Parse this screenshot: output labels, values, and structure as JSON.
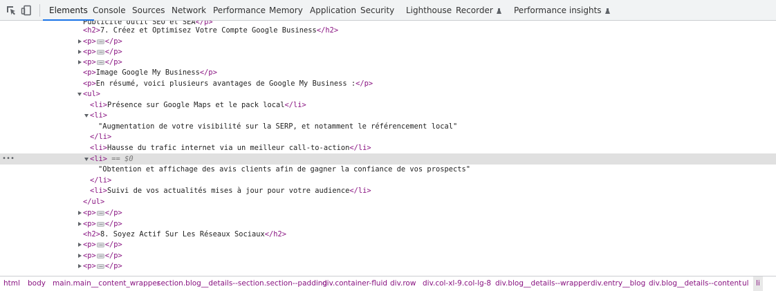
{
  "toolbar": {
    "tabs": [
      {
        "label": "Elements",
        "active": true
      },
      {
        "label": "Console"
      },
      {
        "label": "Sources"
      },
      {
        "label": "Network"
      },
      {
        "label": "Performance"
      },
      {
        "label": "Memory"
      },
      {
        "label": "Application"
      },
      {
        "label": "Security"
      },
      {
        "label": "Lighthouse"
      },
      {
        "label": "Recorder",
        "experimental": true
      },
      {
        "label": "Performance insights",
        "experimental": true
      }
    ]
  },
  "dom": {
    "lines": [
      {
        "text": "Publicité outil SEO et SEA"
      },
      {
        "open": "<h2>",
        "text": "7. Créez et Optimisez Votre Compte Google Business",
        "close": "</h2>"
      },
      {
        "open": "<p>",
        "close": "</p>",
        "collapsed": true
      },
      {
        "open": "<p>",
        "close": "</p>",
        "collapsed": true
      },
      {
        "open": "<p>",
        "close": "</p>",
        "collapsed": true
      },
      {
        "open": "<p>",
        "text": "Image Google My Business",
        "close": "</p>"
      },
      {
        "open": "<p>",
        "text": "En résumé, voici plusieurs avantages de Google My Business :",
        "close": "</p>"
      },
      {
        "open": "<ul>"
      },
      {
        "open": "<li>",
        "text": "Présence sur Google Maps et le pack local",
        "close": "</li>"
      },
      {
        "open": "<li>"
      },
      {
        "text": "\"Augmentation de votre visibilité sur la SERP, et notamment le référencement local\""
      },
      {
        "close": "</li>"
      },
      {
        "open": "<li>",
        "text": "Hausse du trafic internet via un meilleur call-to-action",
        "close": "</li>"
      },
      {
        "open": "<li>",
        "ref": "== $0",
        "selected": true
      },
      {
        "text": "\"Obtention et affichage des avis clients afin de gagner la confiance de vos prospects\""
      },
      {
        "close": "</li>"
      },
      {
        "open": "<li>",
        "text": "Suivi de vos actualités mises à jour pour votre audience",
        "close": "</li>"
      },
      {
        "close": "</ul>"
      },
      {
        "open": "<p>",
        "close": "</p>",
        "collapsed": true
      },
      {
        "open": "<p>",
        "close": "</p>",
        "collapsed": true
      },
      {
        "open": "<h2>",
        "text": "8. Soyez Actif Sur Les Réseaux Sociaux",
        "close": "</h2>"
      },
      {
        "open": "<p>",
        "close": "</p>",
        "collapsed": true
      },
      {
        "open": "<p>",
        "close": "</p>",
        "collapsed": true
      },
      {
        "open": "<p>",
        "close": "</p>",
        "collapsed": true
      }
    ]
  },
  "breadcrumb": [
    "html",
    "body",
    "main.main__content_wrapper",
    "section.blog__details--section.section--padding",
    "div.container-fluid",
    "div.row",
    "div.col-xl-9.col-lg-8",
    "div.blog__details--wrapper",
    "div.entry__blog",
    "div.blog__details--content",
    "ul",
    "li"
  ],
  "colors": {
    "tag": "#881280",
    "accent": "#1a73e8",
    "selected_row": "#e0e0e0"
  }
}
